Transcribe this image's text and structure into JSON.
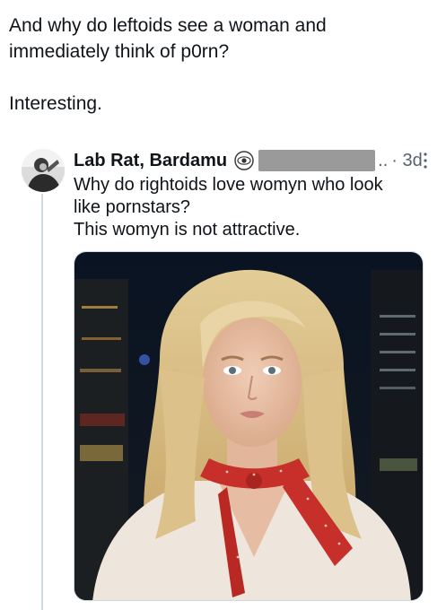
{
  "post": {
    "line1": "And why do leftoids see a woman and",
    "line2": "immediately think of p0rn?",
    "line3": "Interesting."
  },
  "reply": {
    "display_name": "Lab Rat, Bardamu",
    "handle_tail": "..",
    "time": "· 3d",
    "text_line1": "Why do rightoids love womyn who look",
    "text_line2": "like pornstars?",
    "text_line3": "This womyn is not attractive."
  },
  "icons": {
    "verified": "eye-icon",
    "more": "more-dots-icon",
    "avatar": "avatar-photo"
  },
  "colors": {
    "text": "#0f1419",
    "secondary": "#536471",
    "thread_line": "#cfd9de",
    "redaction": "#9a9a9a"
  }
}
